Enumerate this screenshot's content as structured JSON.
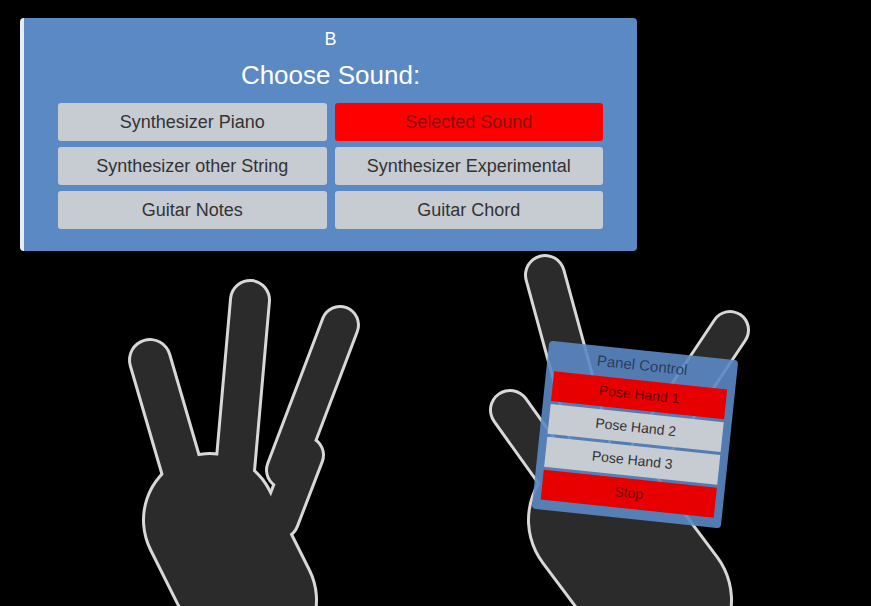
{
  "panel": {
    "label": "B",
    "title": "Choose Sound:"
  },
  "sounds": [
    {
      "label": "Synthesizer Piano",
      "selected": false
    },
    {
      "label": "Selected Sound",
      "selected": true
    },
    {
      "label": "Synthesizer other String",
      "selected": false
    },
    {
      "label": "Synthesizer Experimental",
      "selected": false
    },
    {
      "label": "Guitar Notes",
      "selected": false
    },
    {
      "label": "Guitar Chord",
      "selected": false
    }
  ],
  "hand_panel": {
    "title": "Panel Control",
    "items": [
      {
        "label": "Pose Hand 1",
        "active": true
      },
      {
        "label": "Pose Hand 2",
        "active": false
      },
      {
        "label": "Pose Hand 3",
        "active": false
      },
      {
        "label": "Stop",
        "active": true
      }
    ]
  }
}
